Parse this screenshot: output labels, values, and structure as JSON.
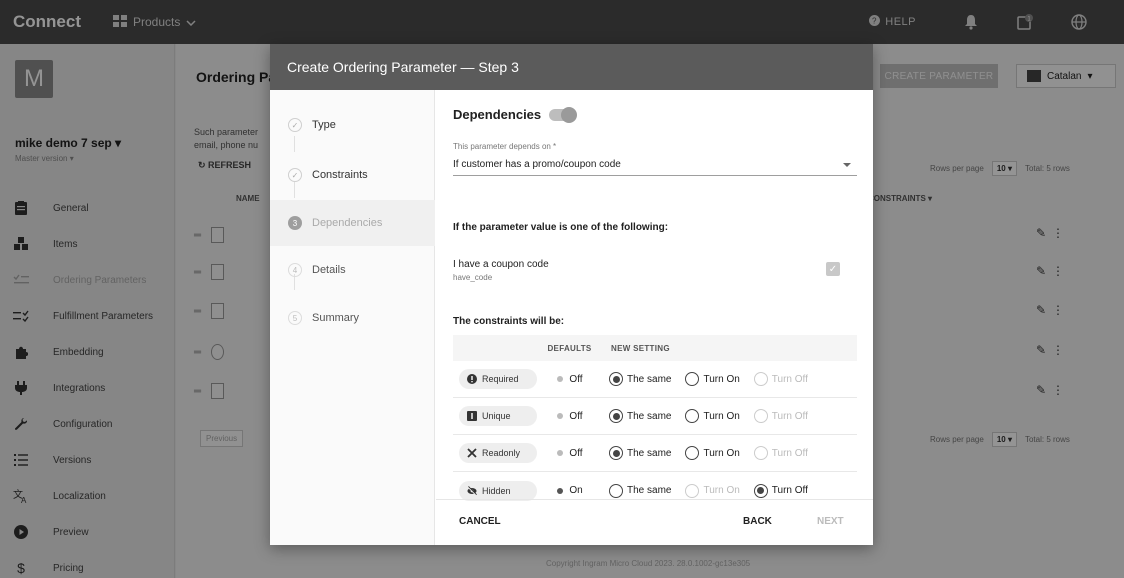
{
  "topbar": {
    "brand": "Connect",
    "products_label": "Products",
    "help_label": "HELP",
    "notification_count": "1"
  },
  "sidebar": {
    "avatar_letter": "M",
    "account_name": "mike demo 7 sep",
    "account_sub": "Master version",
    "items": [
      {
        "label": "General",
        "icon": "clipboard-icon"
      },
      {
        "label": "Items",
        "icon": "boxes-icon"
      },
      {
        "label": "Ordering Parameters",
        "icon": "ordering-params-icon"
      },
      {
        "label": "Fulfillment Parameters",
        "icon": "fulfillment-params-icon"
      },
      {
        "label": "Embedding",
        "icon": "puzzle-icon"
      },
      {
        "label": "Integrations",
        "icon": "plug-icon"
      },
      {
        "label": "Configuration",
        "icon": "wrench-icon"
      },
      {
        "label": "Versions",
        "icon": "list-icon"
      },
      {
        "label": "Localization",
        "icon": "translate-icon"
      },
      {
        "label": "Preview",
        "icon": "play-icon"
      },
      {
        "label": "Pricing",
        "icon": "dollar-icon"
      }
    ]
  },
  "main": {
    "title": "Ordering Pa",
    "desc_line1": "Such parameter",
    "desc_line2": "email, phone nu",
    "refresh_label": "REFRESH",
    "col_name": "NAME",
    "col_constraints": "CONSTRAINTS",
    "create_button": "CREATE PARAMETER",
    "language": "Catalan",
    "rows_per_page_label": "Rows per page",
    "rows_per_page_value": "10",
    "total_rows": "Total: 5 rows",
    "previous_label": "Previous",
    "copyright": "Copyright Ingram Micro Cloud 2023. 28.0.1002-gc13e305"
  },
  "modal": {
    "title": "Create Ordering Parameter — Step 3",
    "steps": [
      {
        "num": "✓",
        "label": "Type",
        "state": "done"
      },
      {
        "num": "✓",
        "label": "Constraints",
        "state": "done"
      },
      {
        "num": "3",
        "label": "Dependencies",
        "state": "current"
      },
      {
        "num": "4",
        "label": "Details",
        "state": "todo"
      },
      {
        "num": "5",
        "label": "Summary",
        "state": "todo"
      }
    ],
    "dependencies_title": "Dependencies",
    "depends_on_label": "This parameter depends on *",
    "depends_on_value": "If customer has a promo/coupon code",
    "if_value_title": "If the parameter value is one of the following:",
    "option_name": "I have a coupon code",
    "option_code": "have_code",
    "constraints_title": "The constraints will be:",
    "table_headers": {
      "defaults": "DEFAULTS",
      "new_setting": "NEW SETTING"
    },
    "constraints": [
      {
        "chip": "Required",
        "icon": "exclamation-icon",
        "default": "Off",
        "selected": "same"
      },
      {
        "chip": "Unique",
        "icon": "unique-icon",
        "default": "Off",
        "selected": "same"
      },
      {
        "chip": "Readonly",
        "icon": "readonly-icon",
        "default": "Off",
        "selected": "same"
      },
      {
        "chip": "Hidden",
        "icon": "eye-off-icon",
        "default": "On",
        "selected": "off"
      }
    ],
    "radio_labels": {
      "same": "The same",
      "on": "Turn On",
      "off": "Turn Off"
    },
    "cancel": "CANCEL",
    "back": "BACK",
    "next": "NEXT"
  }
}
